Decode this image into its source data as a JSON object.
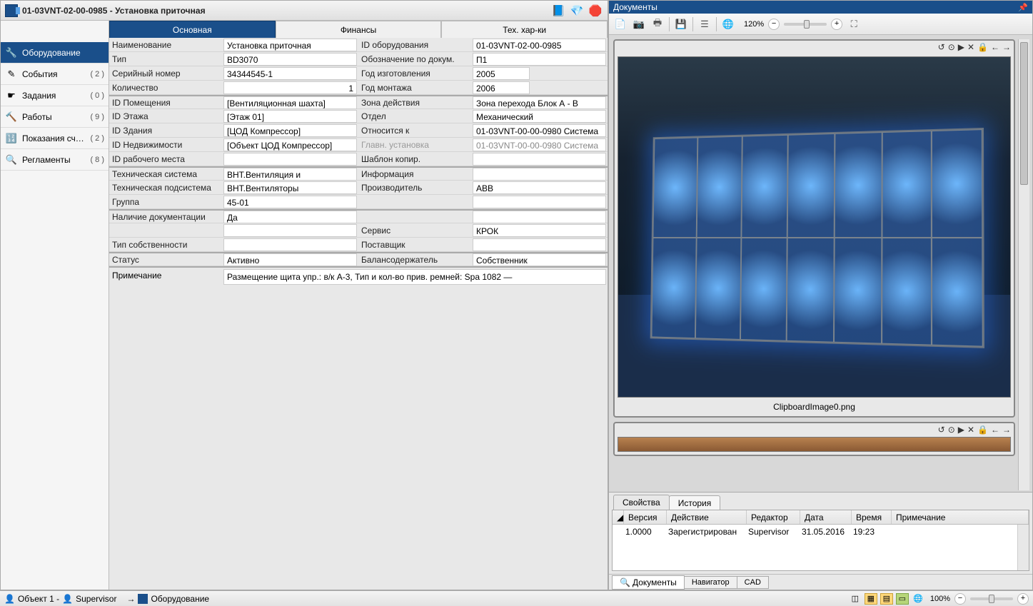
{
  "window": {
    "title": "01-03VNT-02-00-0985 - Установка приточная"
  },
  "sidebar": {
    "items": [
      {
        "label": "Оборудование",
        "count": "",
        "icon": "🔧",
        "active": true
      },
      {
        "label": "События",
        "count": "( 2 )",
        "icon": "✎"
      },
      {
        "label": "Задания",
        "count": "( 0 )",
        "icon": "☛"
      },
      {
        "label": "Работы",
        "count": "( 9 )",
        "icon": "🔨"
      },
      {
        "label": "Показания сч…",
        "count": "( 2 )",
        "icon": "🔢"
      },
      {
        "label": "Регламенты",
        "count": "( 8 )",
        "icon": "🔍"
      }
    ]
  },
  "tabs": {
    "main": "Основная",
    "finance": "Финансы",
    "tech": "Тех. хар-ки"
  },
  "fields": {
    "l": [
      {
        "k": "Наименование",
        "v": "Установка приточная"
      },
      {
        "k": "Тип",
        "v": "BD3070"
      },
      {
        "k": "Серийный номер",
        "v": "34344545-1"
      },
      {
        "k": "Количество",
        "v": "1",
        "num": true
      }
    ],
    "l2": [
      {
        "k": "ID Помещения",
        "v": "[Вентиляционная шахта]"
      },
      {
        "k": "ID Этажа",
        "v": "[Этаж 01]"
      },
      {
        "k": "ID Здания",
        "v": "[ЦОД Компрессор]"
      },
      {
        "k": "ID Недвижимости",
        "v": "[Объект ЦОД Компрессор]"
      },
      {
        "k": "ID рабочего места",
        "v": ""
      }
    ],
    "l3": [
      {
        "k": "Техническая система",
        "v": "ВНТ.Вентиляция и"
      },
      {
        "k": "Техническая подсистема",
        "v": "ВНТ.Вентиляторы"
      },
      {
        "k": "Группа",
        "v": "45-01"
      }
    ],
    "l4": [
      {
        "k": "Наличие документации",
        "v": "Да"
      },
      {
        "k": "",
        "v": ""
      },
      {
        "k": "Тип собственности",
        "v": ""
      }
    ],
    "l5": [
      {
        "k": "Статус",
        "v": "Активно"
      }
    ],
    "r": [
      {
        "k": "ID оборудования",
        "v": "01-03VNT-02-00-0985"
      },
      {
        "k": "Обозначение по докум.",
        "v": "П1"
      },
      {
        "k": "Год изготовления",
        "v": "2005",
        "short": true
      },
      {
        "k": "Год монтажа",
        "v": "2006",
        "short": true
      }
    ],
    "r2": [
      {
        "k": "Зона действия",
        "v": "Зона перехода Блок А - В"
      },
      {
        "k": "Отдел",
        "v": "Механический"
      },
      {
        "k": "Относится к",
        "v": "01-03VNT-00-00-0980 Система"
      },
      {
        "k": "Главн. установка",
        "v": "01-03VNT-00-00-0980 Система",
        "dim": true
      },
      {
        "k": "Шаблон копир.",
        "v": ""
      }
    ],
    "r3": [
      {
        "k": "Информация",
        "v": ""
      },
      {
        "k": "Производитель",
        "v": "ABB"
      },
      {
        "k": "",
        "v": ""
      }
    ],
    "r4": [
      {
        "k": "",
        "v": ""
      },
      {
        "k": "Сервис",
        "v": "КРОК"
      },
      {
        "k": "Поставщик",
        "v": ""
      }
    ],
    "r5": [
      {
        "k": "Балансодержатель",
        "v": "Собственник"
      }
    ],
    "note": {
      "k": "Примечание",
      "v": "Размещение щита упр.: в/к А-3, Тип и кол-во прив. ремней: Spa 1082 —"
    }
  },
  "docs": {
    "panel_title": "Документы",
    "zoom": "120%",
    "image_caption": "ClipboardImage0.png",
    "tabs": {
      "props": "Свойства",
      "history": "История"
    },
    "history": {
      "headers": {
        "ver": "Версия",
        "act": "Действие",
        "ed": "Редактор",
        "dt": "Дата",
        "tm": "Время",
        "nt": "Примечание"
      },
      "rows": [
        {
          "ver": "1.0000",
          "act": "Зарегистрирован",
          "ed": "Supervisor",
          "dt": "31.05.2016",
          "tm": "19:23",
          "nt": ""
        }
      ]
    },
    "bottom_tabs": {
      "docs": "Документы",
      "nav": "Навигатор",
      "cad": "CAD"
    }
  },
  "status": {
    "left1": "Объект 1 -",
    "left2": "Supervisor",
    "arrow": "→",
    "crumb": "Оборудование",
    "zoom": "100%"
  }
}
